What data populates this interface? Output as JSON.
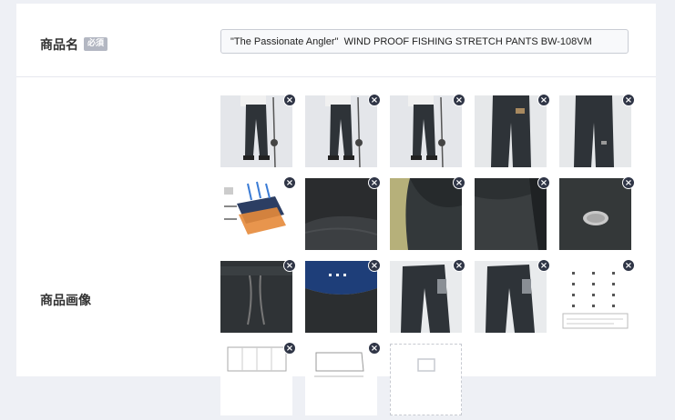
{
  "product_name": {
    "label": "商品名",
    "required_badge": "必須",
    "value": "\"The Passionate Angler\"  WIND PROOF FISHING STRETCH PANTS BW-108VM"
  },
  "product_images": {
    "label": "商品画像",
    "delete_icon": "close-icon",
    "colors": {
      "delete_button": "#2f3546",
      "pants": "#2e3338",
      "background": "#eef0f5"
    },
    "images": [
      {
        "kind": "person-front"
      },
      {
        "kind": "person-front-rod"
      },
      {
        "kind": "person-side-rod"
      },
      {
        "kind": "pants-back"
      },
      {
        "kind": "pants-side"
      },
      {
        "kind": "fabric-diagram"
      },
      {
        "kind": "fleece-closeup"
      },
      {
        "kind": "fabric-fold"
      },
      {
        "kind": "fabric-fold-dark"
      },
      {
        "kind": "vent-closeup"
      },
      {
        "kind": "waist-drawstring"
      },
      {
        "kind": "blue-lining"
      },
      {
        "kind": "pants-flat"
      },
      {
        "kind": "pants-flat-2"
      },
      {
        "kind": "size-chart"
      },
      {
        "kind": "size-table"
      },
      {
        "kind": "measurement-diagram"
      }
    ]
  }
}
